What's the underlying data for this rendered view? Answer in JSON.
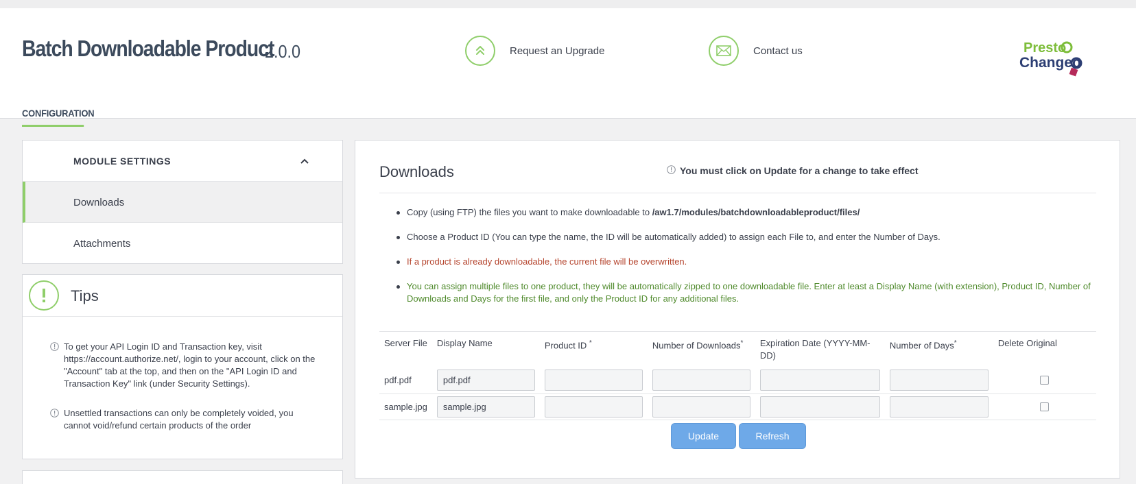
{
  "header": {
    "title": "Batch Downloadable Product",
    "version": "2.0.0",
    "upgrade_label": "Request an Upgrade",
    "contact_label": "Contact us",
    "logo_line1": "Presto",
    "logo_line2": "Changeo",
    "tab_label": "CONFIGURATION"
  },
  "colors": {
    "accent": "#8fce6a",
    "button": "#6ea9e8",
    "warning_text": "#b5452e",
    "info_text": "#4f8a2c"
  },
  "sidebar": {
    "section_title": "MODULE SETTINGS",
    "items": [
      {
        "label": "Downloads",
        "active": true
      },
      {
        "label": "Attachments",
        "active": false
      }
    ]
  },
  "tips": {
    "title": "Tips",
    "items": [
      "To get your API Login ID and Transaction key, visit https://account.authorize.net/, login to your account, click on the \"Account\" tab at the top, and then on the \"API Login ID and Transaction Key\" link (under Security Settings).",
      "Unsettled transactions can only be completely voided, you cannot void/refund certain products of the order"
    ]
  },
  "main": {
    "title": "Downloads",
    "notice": "You must click on Update for a change to take effect",
    "bullet1_prefix": "Copy (using FTP) the files you want to make downloadable to ",
    "bullet1_path": "/aw1.7/modules/batchdownloadableproduct/files/",
    "bullet2": "Choose a Product ID (You can type the name, the ID will be automatically added) to assign each File to, and enter the Number of Days.",
    "bullet3": "If a product is already downloadable, the current file will be overwritten.",
    "bullet4": "You can assign multiple files to one product, they will be automatically zipped to one downloadable file. Enter at least a Display Name (with extension), Product ID, Number of Downloads and Days for the first file, and only the Product ID for any additional files.",
    "table": {
      "headers": {
        "server_file": "Server File",
        "display_name": "Display Name",
        "product_id": "Product ID",
        "num_downloads": "Number of Downloads",
        "expiration": "Expiration Date (YYYY-MM-DD)",
        "num_days": "Number of Days",
        "delete_original": "Delete Original"
      },
      "required_mark": "*",
      "rows": [
        {
          "server_file": "pdf.pdf",
          "display_name": "pdf.pdf",
          "product_id": "",
          "num_downloads": "",
          "expiration": "",
          "num_days": ""
        },
        {
          "server_file": "sample.jpg",
          "display_name": "sample.jpg",
          "product_id": "",
          "num_downloads": "",
          "expiration": "",
          "num_days": ""
        }
      ]
    },
    "update_label": "Update",
    "refresh_label": "Refresh"
  }
}
